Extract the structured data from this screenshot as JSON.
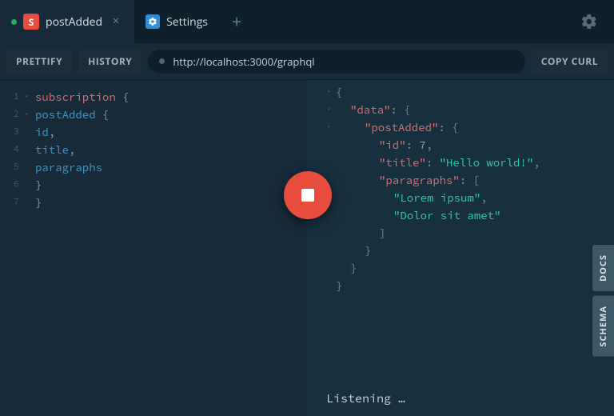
{
  "tabs": [
    {
      "badge": "S",
      "label": "postAdded",
      "active": true,
      "closeable": true,
      "running": true
    },
    {
      "gear": true,
      "label": "Settings",
      "active": false,
      "closeable": false
    }
  ],
  "toolbar": {
    "prettify": "PRETTIFY",
    "history": "HISTORY",
    "copy_curl": "COPY CURL",
    "endpoint": "http://localhost:3000/graphql"
  },
  "editor": {
    "lines": [
      {
        "n": 1,
        "fold": true,
        "tokens": [
          [
            "kw",
            "subscription"
          ],
          [
            "punc",
            " {"
          ]
        ]
      },
      {
        "n": 2,
        "fold": true,
        "tokens": [
          [
            "punc",
            "  "
          ],
          [
            "field",
            "postAdded"
          ],
          [
            "punc",
            " {"
          ]
        ]
      },
      {
        "n": 3,
        "fold": false,
        "tokens": [
          [
            "punc",
            "    "
          ],
          [
            "field",
            "id"
          ],
          [
            "punc",
            ","
          ]
        ]
      },
      {
        "n": 4,
        "fold": false,
        "tokens": [
          [
            "punc",
            "    "
          ],
          [
            "field",
            "title"
          ],
          [
            "punc",
            ","
          ]
        ]
      },
      {
        "n": 5,
        "fold": false,
        "tokens": [
          [
            "punc",
            "    "
          ],
          [
            "field",
            "paragraphs"
          ]
        ]
      },
      {
        "n": 6,
        "fold": false,
        "tokens": [
          [
            "punc",
            "  }"
          ]
        ]
      },
      {
        "n": 7,
        "fold": false,
        "tokens": [
          [
            "punc",
            "}"
          ]
        ]
      }
    ]
  },
  "result": {
    "lines": [
      {
        "fold": true,
        "indent": 0,
        "tokens": [
          [
            "rpunc",
            "{"
          ]
        ]
      },
      {
        "fold": true,
        "indent": 1,
        "tokens": [
          [
            "key",
            "\"data\""
          ],
          [
            "rpunc",
            ": {"
          ]
        ]
      },
      {
        "fold": true,
        "indent": 2,
        "tokens": [
          [
            "key",
            "\"postAdded\""
          ],
          [
            "rpunc",
            ": {"
          ]
        ]
      },
      {
        "fold": false,
        "indent": 3,
        "tokens": [
          [
            "key",
            "\"id\""
          ],
          [
            "rpunc",
            ": "
          ],
          [
            "num",
            "7"
          ],
          [
            "rpunc",
            ","
          ]
        ]
      },
      {
        "fold": false,
        "indent": 3,
        "tokens": [
          [
            "key",
            "\"title\""
          ],
          [
            "rpunc",
            ": "
          ],
          [
            "str",
            "\"Hello world!\""
          ],
          [
            "rpunc",
            ","
          ]
        ]
      },
      {
        "fold": false,
        "indent": 3,
        "tokens": [
          [
            "key",
            "\"paragraphs\""
          ],
          [
            "rpunc",
            ": ["
          ]
        ]
      },
      {
        "fold": false,
        "indent": 4,
        "tokens": [
          [
            "str",
            "\"Lorem ipsum\""
          ],
          [
            "rpunc",
            ","
          ]
        ]
      },
      {
        "fold": false,
        "indent": 4,
        "tokens": [
          [
            "str",
            "\"Dolor sit amet\""
          ]
        ]
      },
      {
        "fold": false,
        "indent": 3,
        "tokens": [
          [
            "rpunc",
            "]"
          ]
        ]
      },
      {
        "fold": false,
        "indent": 2,
        "tokens": [
          [
            "rpunc",
            "}"
          ]
        ]
      },
      {
        "fold": false,
        "indent": 1,
        "tokens": [
          [
            "rpunc",
            "}"
          ]
        ]
      },
      {
        "fold": false,
        "indent": 0,
        "tokens": [
          [
            "rpunc",
            "}"
          ]
        ]
      }
    ]
  },
  "status": "Listening …",
  "rail": {
    "docs": "DOCS",
    "schema": "SCHEMA"
  }
}
